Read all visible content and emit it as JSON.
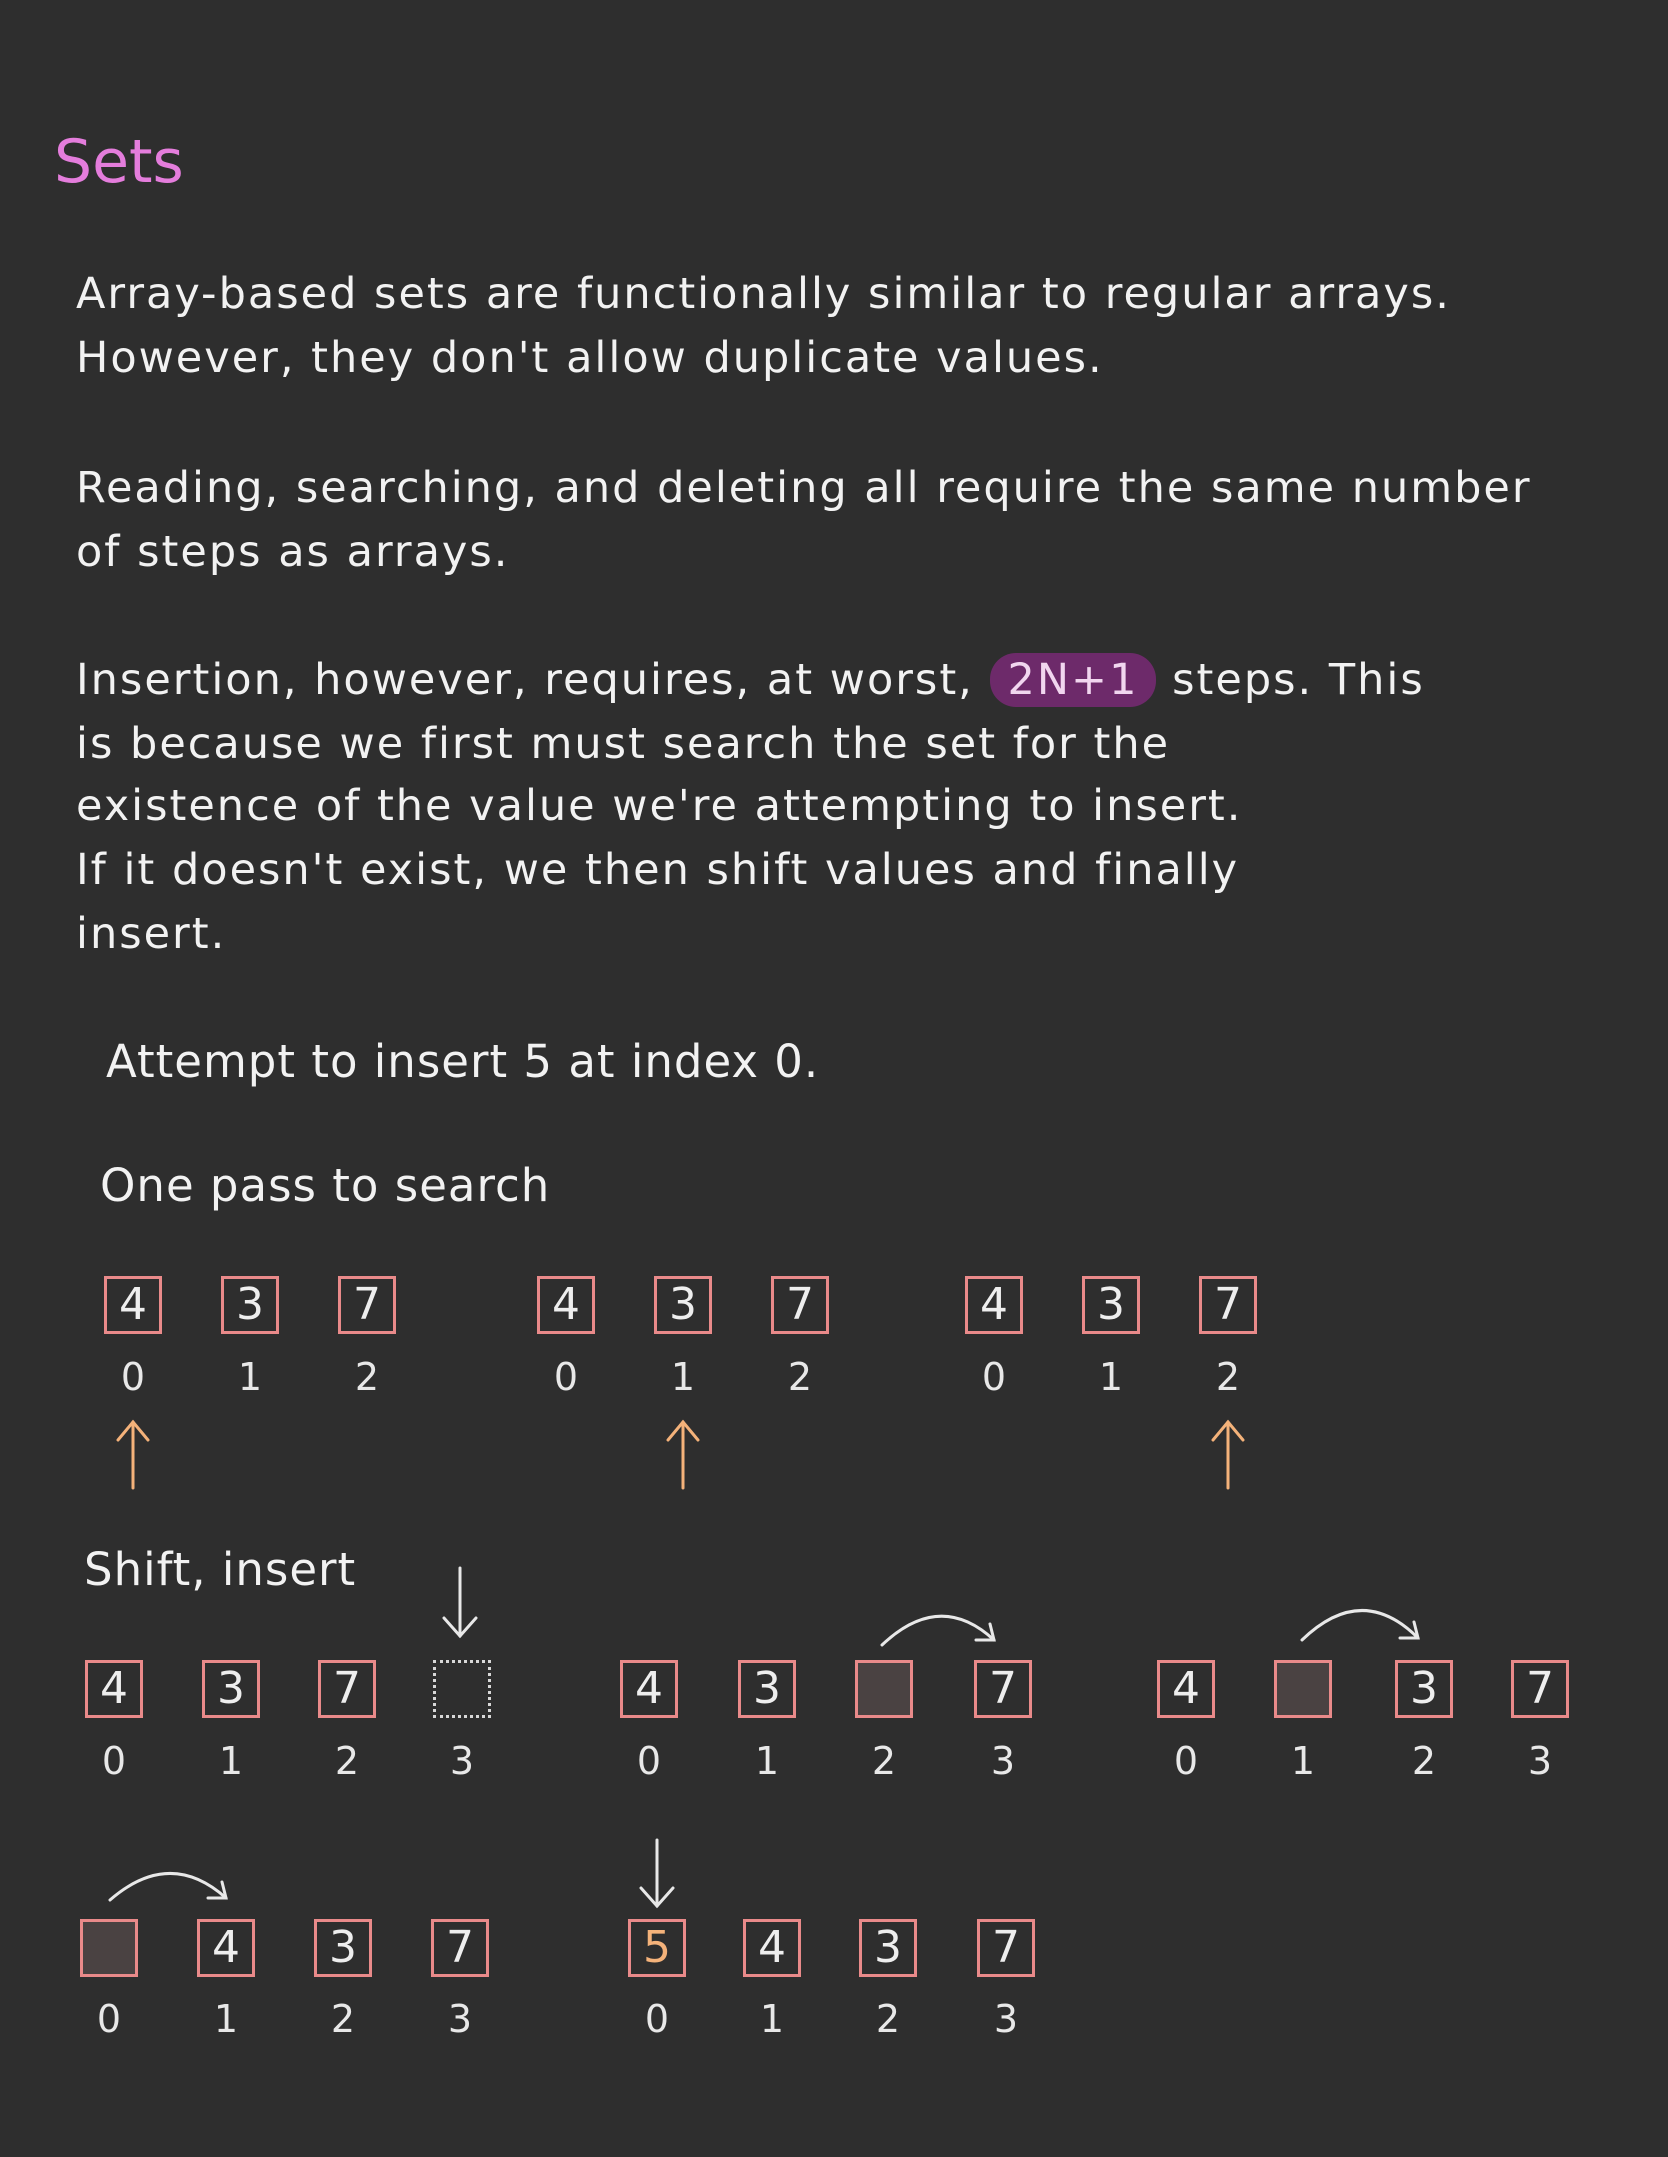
{
  "title": "Sets",
  "paragraphs": {
    "p1": [
      "Array-based sets are functionally similar to regular arrays.",
      "However, they don't allow duplicate values."
    ],
    "p2": [
      "Reading, searching, and deleting all require the same number",
      "of steps as arrays."
    ],
    "p3_line1_before": "Insertion, however, requires, at worst, ",
    "p3_highlight": "2N+1",
    "p3_line1_after": " steps. This",
    "p3_rest": [
      "is because we first must search the set for the",
      "existence of the value we're attempting to insert.",
      "If it doesn't exist, we then shift values and finally",
      "insert."
    ]
  },
  "attempt_label": "Attempt to insert 5 at index 0.",
  "search_label": "One pass to search",
  "shift_label": "Shift, insert",
  "search_steps": [
    {
      "values": [
        "4",
        "3",
        "7"
      ],
      "indices": [
        "0",
        "1",
        "2"
      ],
      "pointer_index": 0
    },
    {
      "values": [
        "4",
        "3",
        "7"
      ],
      "indices": [
        "0",
        "1",
        "2"
      ],
      "pointer_index": 1
    },
    {
      "values": [
        "4",
        "3",
        "7"
      ],
      "indices": [
        "0",
        "1",
        "2"
      ],
      "pointer_index": 2
    }
  ],
  "shift_steps": [
    {
      "values": [
        "4",
        "3",
        "7",
        ""
      ],
      "indices": [
        "0",
        "1",
        "2",
        "3"
      ],
      "slots": [
        "filled",
        "filled",
        "filled",
        "dotted"
      ]
    },
    {
      "values": [
        "4",
        "3",
        "",
        "7"
      ],
      "indices": [
        "0",
        "1",
        "2",
        "3"
      ],
      "slots": [
        "filled",
        "filled",
        "empty",
        "filled"
      ]
    },
    {
      "values": [
        "4",
        "",
        "3",
        "7"
      ],
      "indices": [
        "0",
        "1",
        "2",
        "3"
      ],
      "slots": [
        "filled",
        "empty",
        "filled",
        "filled"
      ]
    },
    {
      "values": [
        "",
        "4",
        "3",
        "7"
      ],
      "indices": [
        "0",
        "1",
        "2",
        "3"
      ],
      "slots": [
        "empty",
        "filled",
        "filled",
        "filled"
      ]
    },
    {
      "values": [
        "5",
        "4",
        "3",
        "7"
      ],
      "indices": [
        "0",
        "1",
        "2",
        "3"
      ],
      "slots": [
        "new",
        "filled",
        "filled",
        "filled"
      ]
    }
  ],
  "colors": {
    "background": "#2e2e2e",
    "title": "#e47ddc",
    "cell_border": "#e98a8a",
    "pointer_arrow": "#f4b27a",
    "highlight_bg": "#6d2a6a",
    "inserted_value": "#f4b27a"
  }
}
